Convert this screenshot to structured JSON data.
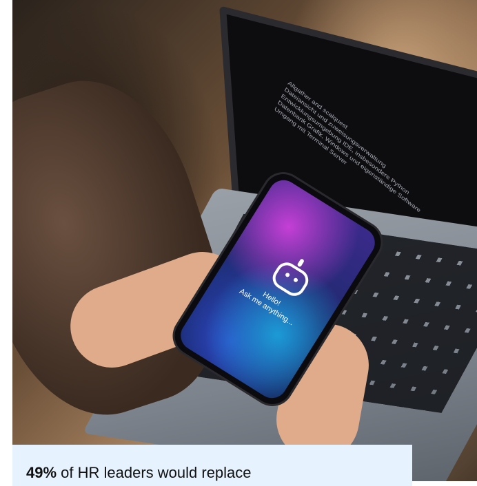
{
  "laptop": {
    "screen_lines": [
      "Allgather and scalquest",
      "Dateiansicht und zuweisungsverwaltung",
      "Entwicklungsumgebung IDE, insbesondere Python",
      "Datenbank Grafik, Windows und eigenständige Software",
      "Umgang mit Terminal Server"
    ]
  },
  "phone": {
    "greeting": "Hello!",
    "prompt": "Ask me anything..."
  },
  "caption": {
    "stat": "49%",
    "text": " of HR leaders would replace"
  }
}
